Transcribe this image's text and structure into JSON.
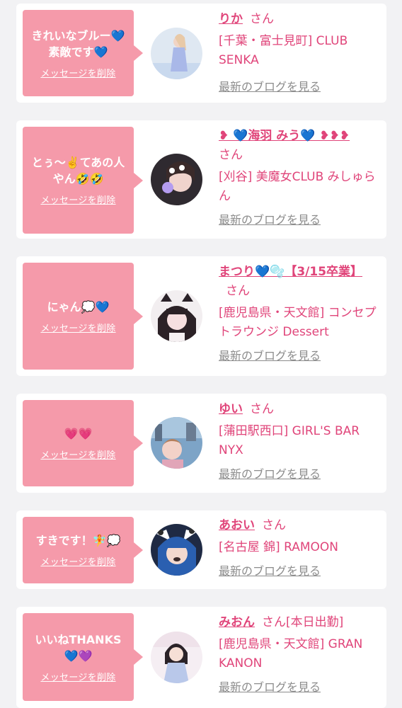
{
  "messages": [
    {
      "bubble": "きれいなブルー💙素敵です💙",
      "delete_label": "メッセージを削除",
      "name": "りか",
      "honorific": "さん",
      "shop": "[千葉・富士見町] CLUB SENKA",
      "blog_label": "最新のブログを見る",
      "avatar_icon": "profile-photo-icon"
    },
    {
      "bubble": "とぅ〜✌️てあの人やん🤣🤣",
      "delete_label": "メッセージを削除",
      "name": "❥ 💙海羽 みう💙 ❥❥❥",
      "honorific": "さん",
      "shop": "[刈谷] 美魔女CLUB みしゅらん",
      "blog_label": "最新のブログを見る",
      "avatar_icon": "profile-photo-icon"
    },
    {
      "bubble": "にゃん💭💙",
      "delete_label": "メッセージを削除",
      "name": "まつり💙🫧【3/15卒業】",
      "honorific": "さん",
      "shop": "[鹿児島県・天文館] コンセプトラウンジ Dessert",
      "blog_label": "最新のブログを見る",
      "avatar_icon": "profile-photo-icon"
    },
    {
      "bubble": "💗💗",
      "delete_label": "メッセージを削除",
      "name": "ゆい",
      "honorific": "さん",
      "shop": "[蒲田駅西口] GIRL'S BAR NYX",
      "blog_label": "最新のブログを見る",
      "avatar_icon": "profile-photo-icon"
    },
    {
      "bubble": "すきです！🧚💭",
      "delete_label": "メッセージを削除",
      "name": "あおい",
      "honorific": "さん",
      "shop": "[名古屋 錦] RAMOON",
      "blog_label": "最新のブログを見る",
      "avatar_icon": "profile-photo-icon"
    },
    {
      "bubble": "いいねTHANKS💙💜",
      "delete_label": "メッセージを削除",
      "name": "みおん",
      "honorific": "さん[本日出勤]",
      "shop": "[鹿児島県・天文館] GRAN KANON",
      "blog_label": "最新のブログを見る",
      "avatar_icon": "profile-photo-icon"
    }
  ],
  "colors": {
    "bubble": "#f59aaa",
    "accent": "#e0457a",
    "link_gray": "#8c8c8c",
    "background": "#f2f2f4"
  }
}
